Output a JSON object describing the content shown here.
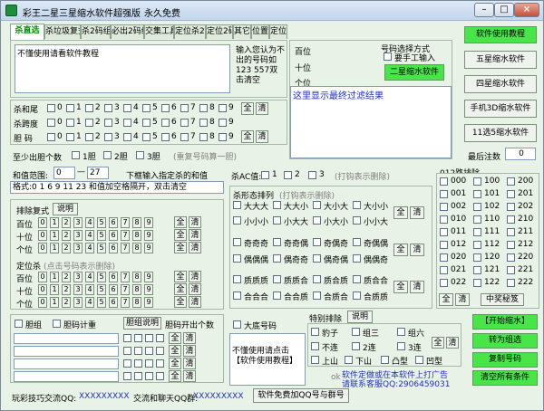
{
  "window": {
    "title_left": "彩王二星三星缩水软件超强版",
    "title_right": "永久免费"
  },
  "tabs": [
    "杀直选",
    "杀垃圾复式",
    "杀2码组合",
    "必出2码组合",
    "交集工具",
    "定位杀2码",
    "定位2码",
    "其它",
    "位置匹配",
    "定位胆"
  ],
  "kill_input": {
    "value": "不懂使用请看软件教程",
    "hint": "输入您认为不出的号码如123 557双击清空"
  },
  "filter": {
    "bai": "百位",
    "shi": "十位",
    "ge": "个位",
    "mode_title": "号码选择方式",
    "manual": "要手工输入",
    "run": "二星缩水软件",
    "result": "这里显示最终过滤结果"
  },
  "right_btns": [
    "软件使用教程",
    "五星缩水软件",
    "四星缩水软件",
    "手机3D缩水软件",
    "11选5缩水软件"
  ],
  "min_notes": {
    "label": "最后注数",
    "value": "0"
  },
  "kill_rows": [
    "杀和尾",
    "杀跨度",
    "胆  码"
  ],
  "digits": [
    "0",
    "1",
    "2",
    "3",
    "4",
    "5",
    "6",
    "7",
    "8",
    "9"
  ],
  "all": "全",
  "clear": "清",
  "dan_count": {
    "label": "至少出胆个数",
    "opt1": "1胆",
    "opt2": "2胆",
    "opt3": "3胆",
    "note": "(重复号码算一胆)"
  },
  "sum": {
    "label": "和值范围:",
    "from": "0",
    "to": "27",
    "note": "下框输入指定杀的和值",
    "format": "格式:0 1 6 9 11 23 和值加空格隔开，双击清空"
  },
  "ac": {
    "label": "杀AC值:",
    "o1": "1",
    "o2": "2",
    "o3": "3",
    "note": "(打钩表示删除)"
  },
  "form": {
    "title": "杀形态排列",
    "note": "(打钩表示删除)",
    "r1": [
      "大大大",
      "大大小",
      "大小大",
      "大小小"
    ],
    "r2": [
      "小小小",
      "小大大",
      "小大小",
      "小小大"
    ],
    "r3": [
      "奇奇奇",
      "奇奇偶",
      "奇偶奇",
      "奇偶偶"
    ],
    "r4": [
      "偶偶偶",
      "偶奇奇",
      "偶奇偶",
      "偶偶奇"
    ],
    "r5": [
      "质质质",
      "质质合",
      "质合质",
      "质合合"
    ],
    "r6": [
      "合合合",
      "合合质",
      "合质合",
      "合质质"
    ]
  },
  "pos_kill": {
    "title": "排除复式",
    "explain": "说明",
    "rows": [
      "百位",
      "十位",
      "个位"
    ],
    "title2": "定位杀",
    "note2": "(点击号码表示删除)"
  },
  "road": {
    "title": "012路排除",
    "cells": [
      "000",
      "100",
      "200",
      "001",
      "101",
      "201",
      "002",
      "102",
      "202",
      "010",
      "110",
      "210",
      "011",
      "111",
      "211",
      "012",
      "112",
      "212",
      "020",
      "120",
      "220",
      "021",
      "121",
      "221",
      "022",
      "122",
      "222"
    ],
    "secret": "中奖秘笈"
  },
  "dan_group": {
    "dan": "胆组",
    "calc": "胆码计重",
    "explain": "胆组说明",
    "count": "胆码开出个数"
  },
  "bigbase": {
    "label": "大底号码",
    "text": "不懂使用请点击【软件使用教程】"
  },
  "special": {
    "title": "特别排除",
    "explain": "说明",
    "o": [
      "豹子",
      "组三",
      "组六",
      "不连",
      "2连",
      "3连",
      "上山",
      "下山",
      "凸型",
      "凹型"
    ],
    "rights": "软件定做或在本软件上打广告",
    "contact": "请联系客服QQ:2906459031"
  },
  "actions": [
    "【开始缩水】",
    "转为组选",
    "复制号码",
    "清空所有条件"
  ],
  "footer": {
    "left_label": "玩彩技巧交流QQ:",
    "left_val": "XXXXXXXXX",
    "mid_label": "交流和聊天QQ群:",
    "mid_val": "XXXXXXXXX",
    "btn": "软件免费加QQ号与群号"
  },
  "colors": {
    "green": "#47e547",
    "blue": "#1f2fc8",
    "tabactive": "#009000"
  }
}
